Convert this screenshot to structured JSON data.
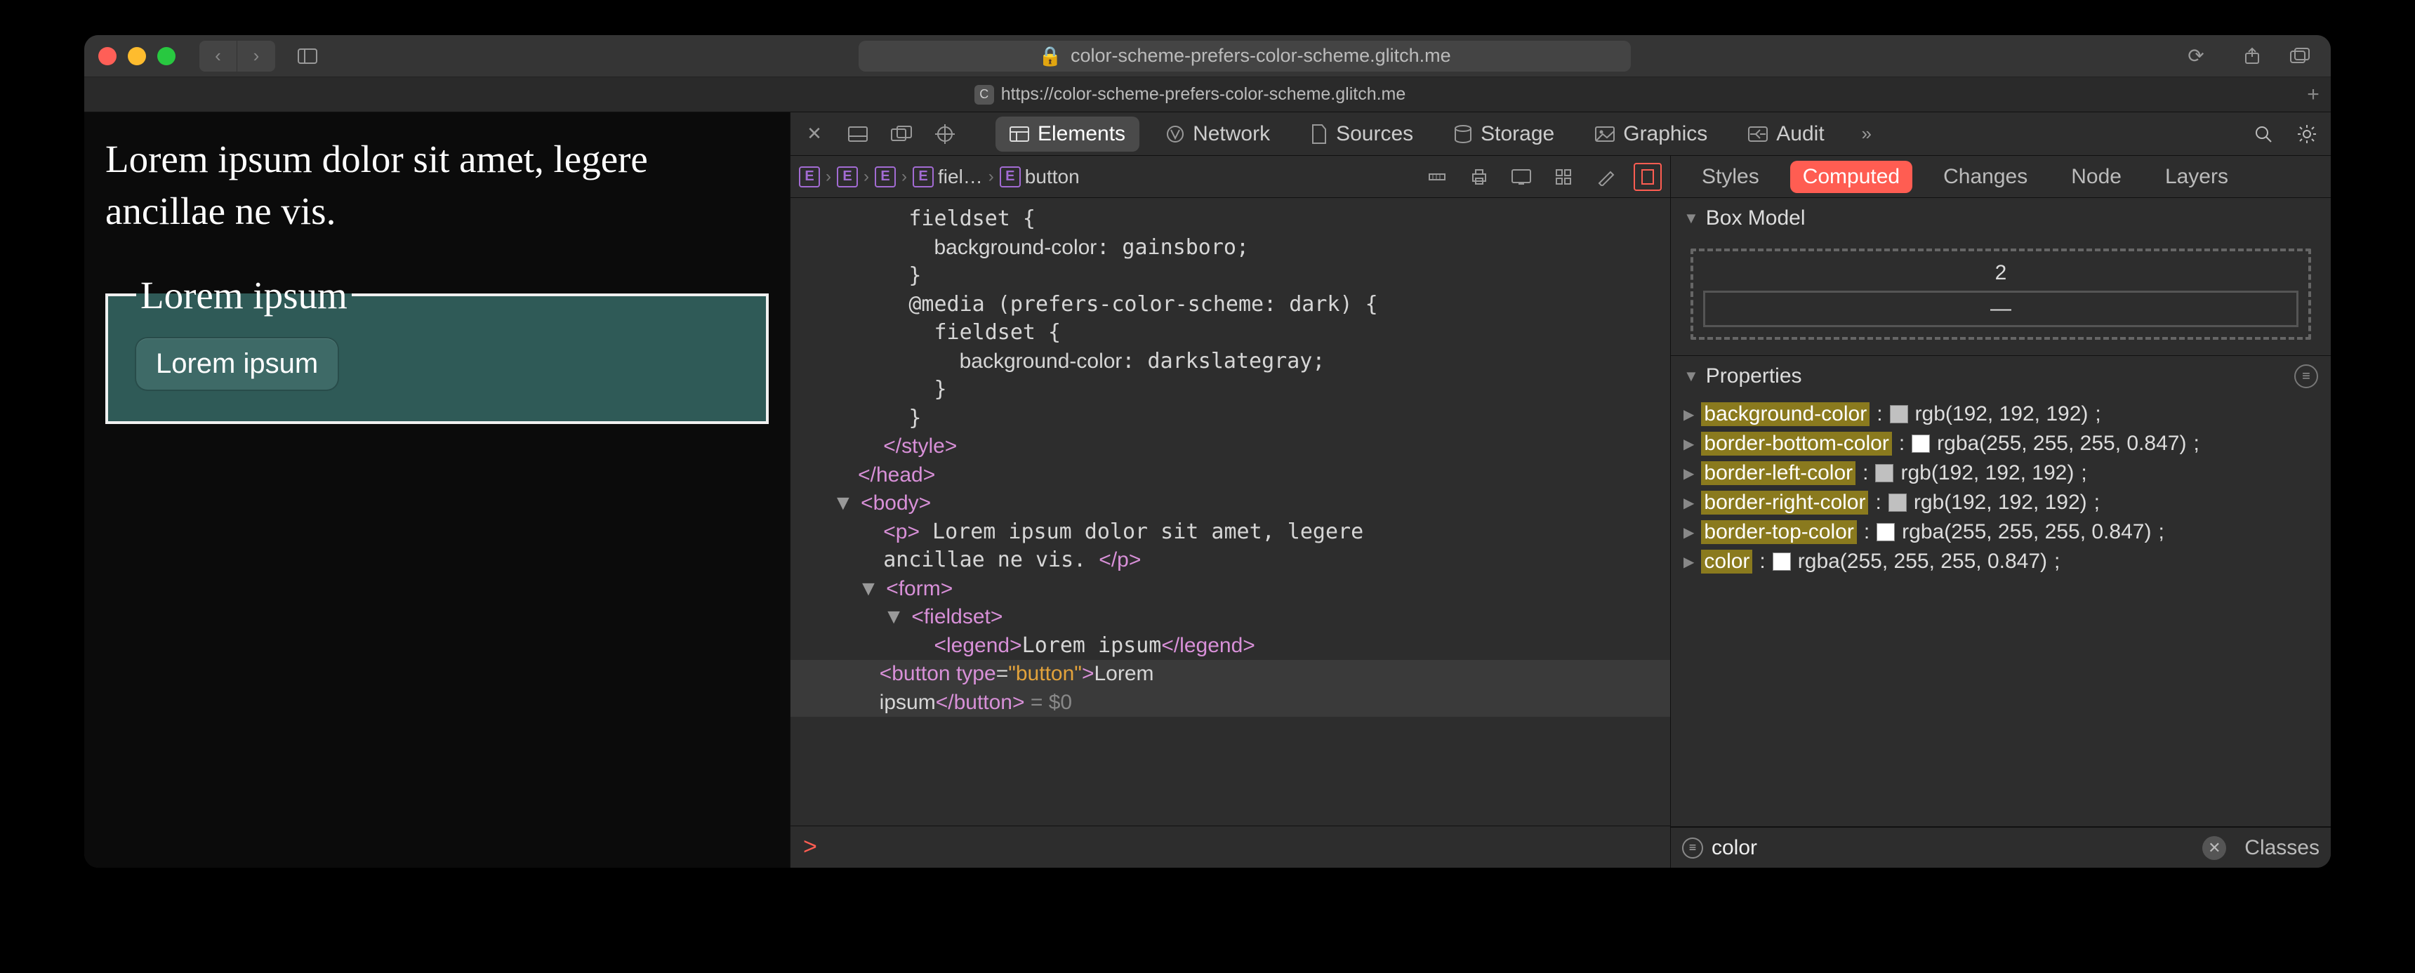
{
  "titlebar": {
    "url_display": "color-scheme-prefers-color-scheme.glitch.me",
    "lock_icon": "lock-icon"
  },
  "tab": {
    "title": "https://color-scheme-prefers-color-scheme.glitch.me",
    "favicon_letter": "C"
  },
  "page": {
    "paragraph": "Lorem ipsum dolor sit amet, legere ancillae ne vis.",
    "legend": "Lorem ipsum",
    "button": "Lorem ipsum"
  },
  "devtools": {
    "tabs": [
      "Elements",
      "Network",
      "Sources",
      "Storage",
      "Graphics",
      "Audit"
    ],
    "active_tab": "Elements",
    "breadcrumbs": [
      "",
      "",
      "",
      "fiel…",
      "button"
    ],
    "source_lines": [
      "      fieldset {",
      "        background-color: gainsboro;",
      "      }",
      "      @media (prefers-color-scheme: dark) {",
      "        fieldset {",
      "          background-color: darkslategray;",
      "        }",
      "      }",
      "    </style>",
      "  </head>",
      "▼ <body>",
      "    <p> Lorem ipsum dolor sit amet, legere ancillae ne vis. </p>",
      "  ▼ <form>",
      "    ▼ <fieldset>",
      "        <legend>Lorem ipsum</legend>",
      "        <button type=\"button\">Lorem ipsum</button> = $0"
    ],
    "console_prompt": ">"
  },
  "sidebar": {
    "tabs": [
      "Styles",
      "Computed",
      "Changes",
      "Node",
      "Layers"
    ],
    "active_tab": "Computed",
    "box_model_title": "Box Model",
    "box_model_top": "2",
    "box_model_inner": "—",
    "properties_title": "Properties",
    "props": [
      {
        "name": "background-color",
        "value": "rgb(192, 192, 192)",
        "swatch": "#c0c0c0"
      },
      {
        "name": "border-bottom-color",
        "value": "rgba(255, 255, 255, 0.847)",
        "swatch": "#ffffff"
      },
      {
        "name": "border-left-color",
        "value": "rgb(192, 192, 192)",
        "swatch": "#c0c0c0"
      },
      {
        "name": "border-right-color",
        "value": "rgb(192, 192, 192)",
        "swatch": "#c0c0c0"
      },
      {
        "name": "border-top-color",
        "value": "rgba(255, 255, 255, 0.847)",
        "swatch": "#ffffff"
      },
      {
        "name": "color",
        "value": "rgba(255, 255, 255, 0.847)",
        "swatch": "#ffffff"
      }
    ],
    "filter_value": "color",
    "classes_label": "Classes"
  }
}
